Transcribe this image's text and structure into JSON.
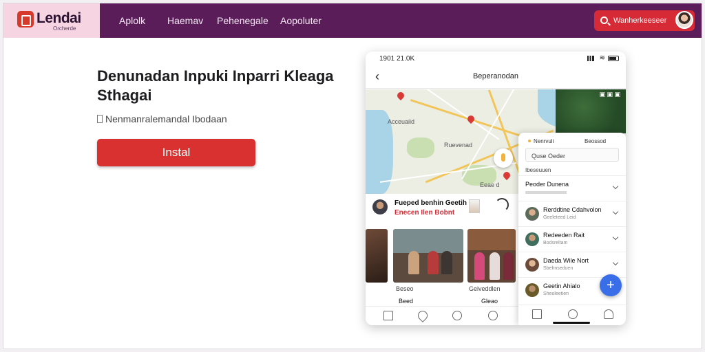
{
  "brand": {
    "name": "Lendai",
    "sub": "Orcherde"
  },
  "nav": [
    "Aplolk",
    "Haemav",
    "Pehenegale",
    "Aopoluter"
  ],
  "search_label": "Wanherkeeseer",
  "hero": {
    "title": "Denunadan Inpuki Inparri Kleaga Sthagai",
    "subtitle": "Nenmanralemandal Ibodaan",
    "install_label": "Instal"
  },
  "phone": {
    "status_time": "1901 21.0K",
    "header_title": "Beperanodan",
    "map_labels": [
      "Acceuaiid",
      "Ruevenad",
      "Eeae d"
    ],
    "post": {
      "name": "Fueped benhin Geetih",
      "link": "Enecen Ilen Bobnt"
    },
    "photo_captions": [
      "Beseo",
      "Geiveddlen"
    ],
    "bottom_row": [
      "Beed",
      "Gleao"
    ],
    "panel": {
      "head_left": "Nenrvuli",
      "head_right": "Beossod",
      "search_value": "Quse Oeder",
      "section_label": "Ibeseuuen",
      "rows": [
        {
          "name": "Peoder Dunena",
          "sub": ""
        },
        {
          "name": "Rerddtine Cdahvolon",
          "sub": "Geeleteed Leid"
        },
        {
          "name": "Redeeden Rait",
          "sub": "Bodsreltam"
        },
        {
          "name": "Daeda Wile Nort",
          "sub": "Sbehnseduen"
        },
        {
          "name": "Geetin Ahialo",
          "sub": "Sheoleetien"
        }
      ],
      "fab_label": "+"
    }
  },
  "colors": {
    "topbar": "#5b1d5a",
    "accent": "#d62b36",
    "fab": "#3a6ee8"
  }
}
